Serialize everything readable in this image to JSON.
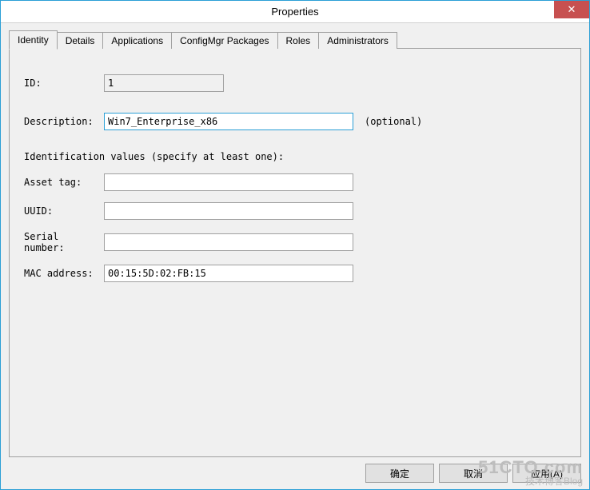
{
  "window": {
    "title": "Properties"
  },
  "tabs": {
    "identity": "Identity",
    "details": "Details",
    "applications": "Applications",
    "configmgr": "ConfigMgr Packages",
    "roles": "Roles",
    "administrators": "Administrators"
  },
  "form": {
    "id_label": "ID:",
    "id_value": "1",
    "description_label": "Description:",
    "description_value": "Win7_Enterprise_x86",
    "optional_hint": "(optional)",
    "ident_section": "Identification values (specify at least one):",
    "asset_label": "Asset tag:",
    "asset_value": "",
    "uuid_label": "UUID:",
    "uuid_value": "",
    "serial_label": "Serial number:",
    "serial_value": "",
    "mac_label": "MAC address:",
    "mac_value": "00:15:5D:02:FB:15"
  },
  "buttons": {
    "ok": "确定",
    "cancel": "取消",
    "apply": "应用(A)"
  },
  "watermark": {
    "line1": "51CTO.com",
    "line2": "技术博客Blog"
  }
}
